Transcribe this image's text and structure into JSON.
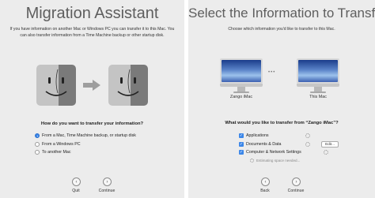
{
  "left": {
    "title": "Migration Assistant",
    "intro": "If you have information on another Mac or Windows PC you can transfer it to this Mac. You can also transfer information from a Time Machine backup or other startup disk.",
    "question": "How do you want to transfer your information?",
    "options": [
      {
        "label": "From a Mac, Time Machine backup, or startup disk",
        "selected": true
      },
      {
        "label": "From a Windows PC",
        "selected": false
      },
      {
        "label": "To another Mac",
        "selected": false
      }
    ],
    "quit_label": "Quit",
    "continue_label": "Continue",
    "colors": {
      "face_light": "#c4c4c4",
      "face_dark": "#7a7a7a",
      "accent": "#3b86e8"
    },
    "icons": {
      "arrow": "right-arrow-icon",
      "back": "chevron-left-icon",
      "forward": "chevron-right-icon"
    }
  },
  "right": {
    "title": "Select the Information to Transfer",
    "intro": "Choose which information you'd like to transfer to this Mac.",
    "source_label": "Zango iMac",
    "dest_label": "This Mac",
    "question": "What would you like to transfer from “Zango iMac”?",
    "items": [
      {
        "label": "Applications",
        "checked": true
      },
      {
        "label": "Documents & Data",
        "checked": true,
        "button": "Edit..."
      },
      {
        "label": "Computer & Network Settings",
        "checked": true
      }
    ],
    "estimating": "Estimating space needed...",
    "back_label": "Back",
    "continue_label": "Continue"
  }
}
